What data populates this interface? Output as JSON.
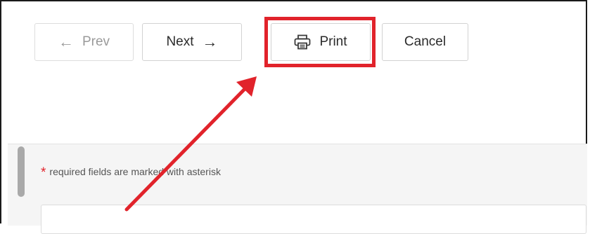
{
  "toolbar": {
    "prev_label": "Prev",
    "prev_arrow": "←",
    "next_label": "Next",
    "next_arrow": "→",
    "print_label": "Print",
    "cancel_label": "Cancel"
  },
  "form": {
    "required_asterisk": "*",
    "required_note": "required fields are marked with asterisk"
  },
  "annotation": {
    "highlight_color": "#e1232b",
    "target": "print-button"
  },
  "icons": {
    "prev": "left-arrow-icon",
    "next": "right-arrow-icon",
    "print": "printer-icon"
  }
}
